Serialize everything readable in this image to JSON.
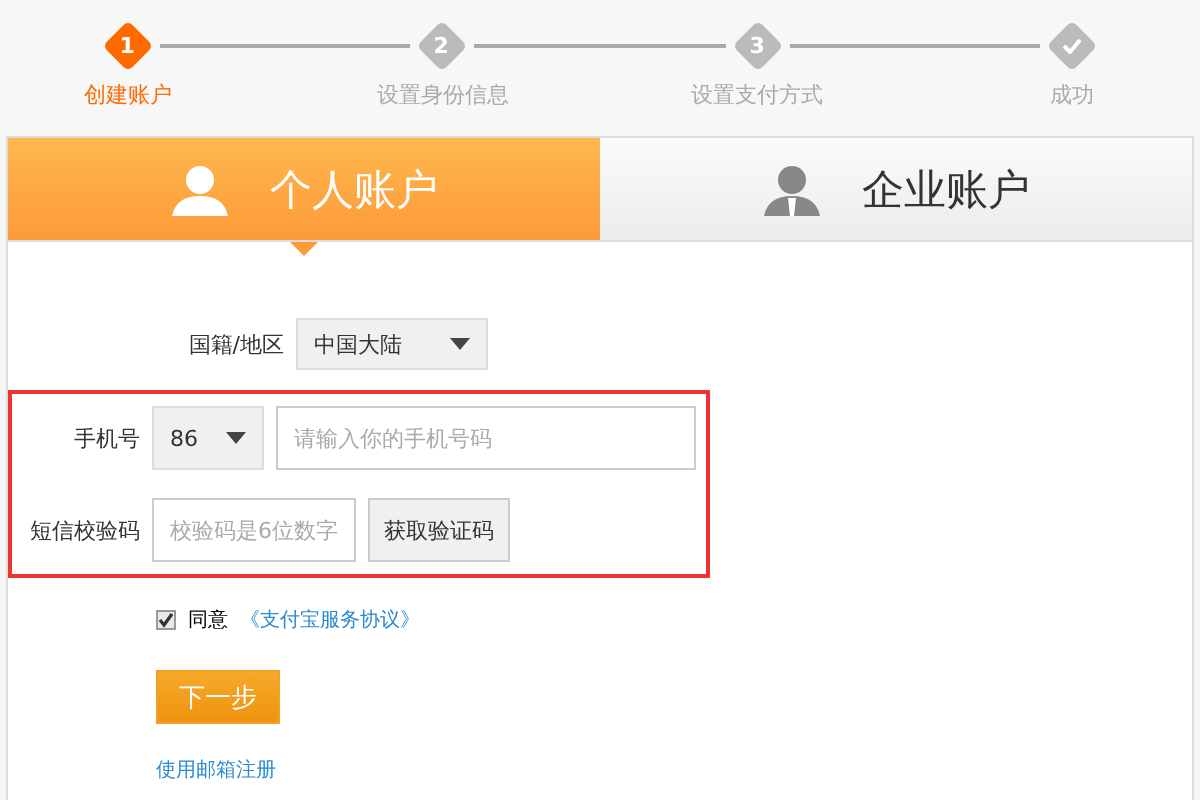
{
  "steps": [
    {
      "number": "1",
      "label": "创建账户",
      "selected": true,
      "kind": "number"
    },
    {
      "number": "2",
      "label": "设置身份信息",
      "selected": false,
      "kind": "number"
    },
    {
      "number": "3",
      "label": "设置支付方式",
      "selected": false,
      "kind": "number"
    },
    {
      "label": "成功",
      "selected": false,
      "kind": "check"
    }
  ],
  "tabs": [
    {
      "label": "个人账户",
      "selected": true,
      "kind": "person"
    },
    {
      "label": "企业账户",
      "selected": false,
      "kind": "business"
    }
  ],
  "form": {
    "region": {
      "label": "国籍/地区",
      "value": "中国大陆"
    },
    "phone": {
      "label": "手机号",
      "code": "86",
      "placeholder": "请输入你的手机号码"
    },
    "sms": {
      "label": "短信校验码",
      "placeholder": "校验码是6位数字",
      "button": "获取验证码"
    },
    "agree": {
      "checked": true,
      "text": "同意",
      "link": "《支付宝服务协议》"
    },
    "next": "下一步",
    "email_link": "使用邮箱注册"
  }
}
